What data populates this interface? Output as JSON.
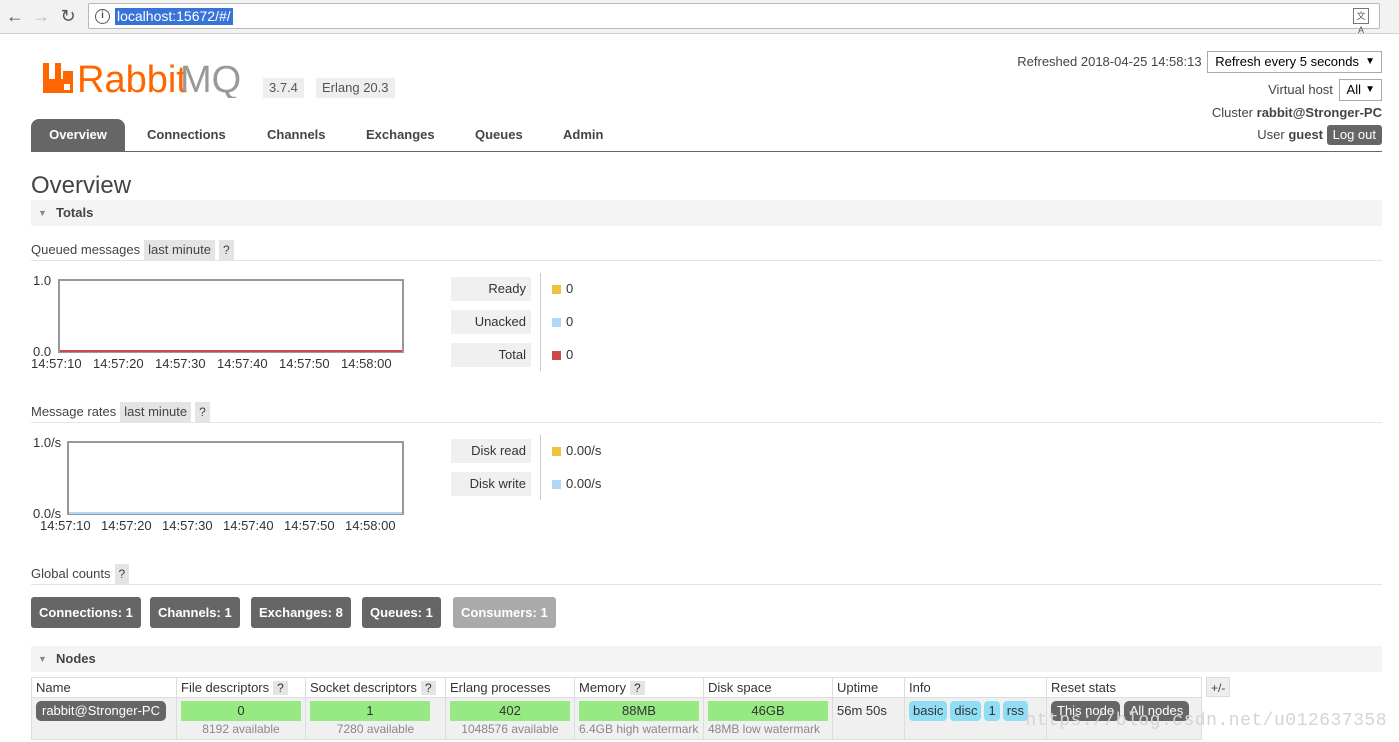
{
  "browser": {
    "url": "localhost:15672/#/",
    "back_icon": "arrow-left",
    "forward_icon": "arrow-right",
    "reload_icon": "reload"
  },
  "app": {
    "logo_text": "RabbitMQ",
    "version": "3.7.4",
    "erlang": "Erlang 20.3",
    "brand_color": "#f60"
  },
  "header": {
    "refreshed_label": "Refreshed 2018-04-25 14:58:13",
    "refresh_select": "Refresh every 5 seconds",
    "vhost_label": "Virtual host",
    "vhost_select": "All",
    "cluster_label": "Cluster",
    "cluster_value": "rabbit@Stronger-PC",
    "user_label": "User",
    "user_value": "guest",
    "logout": "Log out"
  },
  "tabs": [
    "Overview",
    "Connections",
    "Channels",
    "Exchanges",
    "Queues",
    "Admin"
  ],
  "page_title": "Overview",
  "totals": {
    "section_title": "Totals",
    "queued": {
      "label": "Queued messages",
      "range": "last minute",
      "help": "?",
      "legend": [
        {
          "label": "Ready",
          "value": "0",
          "color": "#edc240"
        },
        {
          "label": "Unacked",
          "value": "0",
          "color": "#afd8f8"
        },
        {
          "label": "Total",
          "value": "0",
          "color": "#cb4b4b"
        }
      ]
    },
    "rates": {
      "label": "Message rates",
      "range": "last minute",
      "help": "?",
      "legend": [
        {
          "label": "Disk read",
          "value": "0.00/s",
          "color": "#edc240"
        },
        {
          "label": "Disk write",
          "value": "0.00/s",
          "color": "#afd8f8"
        }
      ]
    },
    "global_counts": {
      "label": "Global counts",
      "help": "?",
      "items": [
        "Connections: 1",
        "Channels: 1",
        "Exchanges: 8",
        "Queues: 1",
        "Consumers: 1"
      ]
    }
  },
  "chart_data": [
    {
      "type": "line",
      "x": [
        "14:57:10",
        "14:57:20",
        "14:57:30",
        "14:57:40",
        "14:57:50",
        "14:58:00"
      ],
      "ytick_labels": [
        "1.0",
        "0.0"
      ],
      "ylim": [
        0,
        1
      ],
      "series": [
        {
          "name": "Ready",
          "values": [
            0,
            0,
            0,
            0,
            0,
            0
          ],
          "color": "#edc240"
        },
        {
          "name": "Unacked",
          "values": [
            0,
            0,
            0,
            0,
            0,
            0
          ],
          "color": "#afd8f8"
        },
        {
          "name": "Total",
          "values": [
            0,
            0,
            0,
            0,
            0,
            0
          ],
          "color": "#cb4b4b"
        }
      ],
      "grid": false
    },
    {
      "type": "line",
      "x": [
        "14:57:10",
        "14:57:20",
        "14:57:30",
        "14:57:40",
        "14:57:50",
        "14:58:00"
      ],
      "ytick_labels": [
        "1.0/s",
        "0.0/s"
      ],
      "ylim": [
        0,
        1
      ],
      "series": [
        {
          "name": "Disk read",
          "values": [
            0,
            0,
            0,
            0,
            0,
            0
          ],
          "color": "#edc240"
        },
        {
          "name": "Disk write",
          "values": [
            0,
            0,
            0,
            0,
            0,
            0
          ],
          "color": "#afd8f8"
        }
      ],
      "grid": false
    }
  ],
  "nodes": {
    "section_title": "Nodes",
    "columns": [
      "Name",
      "File descriptors",
      "Socket descriptors",
      "Erlang processes",
      "Memory",
      "Disk space",
      "Uptime",
      "Info",
      "Reset stats"
    ],
    "help": "?",
    "plus_minus": "+/-",
    "row": {
      "name": "rabbit@Stronger-PC",
      "fd": "0",
      "fd_sub": "8192 available",
      "sd": "1",
      "sd_sub": "7280 available",
      "ep": "402",
      "ep_sub": "1048576 available",
      "mem": "88MB",
      "mem_sub": "6.4GB high watermark",
      "disk": "46GB",
      "disk_sub": "48MB low watermark",
      "uptime": "56m 50s",
      "info": [
        "basic",
        "disc",
        "1",
        "rss"
      ],
      "reset_this": "This node",
      "reset_all": "All nodes"
    }
  },
  "watermark": "https://blog.csdn.net/u012637358"
}
